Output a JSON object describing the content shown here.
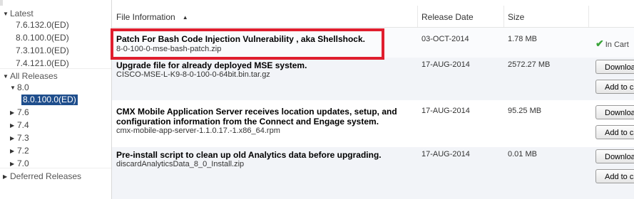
{
  "tree": {
    "latest_label": "Latest",
    "latest_versions": [
      "7.6.132.0(ED)",
      "8.0.100.0(ED)",
      "7.3.101.0(ED)",
      "7.4.121.0(ED)"
    ],
    "all_releases_label": "All Releases",
    "expanded_version": "8.0",
    "selected_release": "8.0.100.0(ED)",
    "collapsed_versions": [
      "7.6",
      "7.4",
      "7.3",
      "7.2",
      "7.0"
    ],
    "deferred_label": "Deferred Releases"
  },
  "table": {
    "headers": {
      "file_info": "File Information",
      "release_date": "Release Date",
      "size": "Size"
    },
    "rows": [
      {
        "title": "Patch For Bash Code Injection Vulnerability , aka Shellshock.",
        "filename": "8-0-100-0-mse-bash-patch.zip",
        "date": "03-OCT-2014",
        "size": "1.78 MB",
        "status": "In Cart"
      },
      {
        "title": "Upgrade file for already deployed MSE system.",
        "filename": "CISCO-MSE-L-K9-8-0-100-0-64bit.bin.tar.gz",
        "date": "17-AUG-2014",
        "size": "2572.27 MB",
        "download_label": "Download",
        "add_label": "Add to cart"
      },
      {
        "title": "CMX Mobile Application Server receives location updates, setup, and configuration information from the Connect and Engage system.",
        "filename": "cmx-mobile-app-server-1.1.0.17.-1.x86_64.rpm",
        "date": "17-AUG-2014",
        "size": "95.25 MB",
        "download_label": "Download",
        "add_label": "Add to cart"
      },
      {
        "title": "Pre-install script to clean up old Analytics data before upgrading.",
        "filename": "discardAnalyticsData_8_0_Install.zip",
        "date": "17-AUG-2014",
        "size": "0.01 MB",
        "download_label": "Download",
        "add_label": "Add to cart"
      }
    ]
  },
  "colors": {
    "highlight_box": "#e01e2e",
    "selected_bg": "#1f4e8c",
    "check": "#3aa43a"
  }
}
